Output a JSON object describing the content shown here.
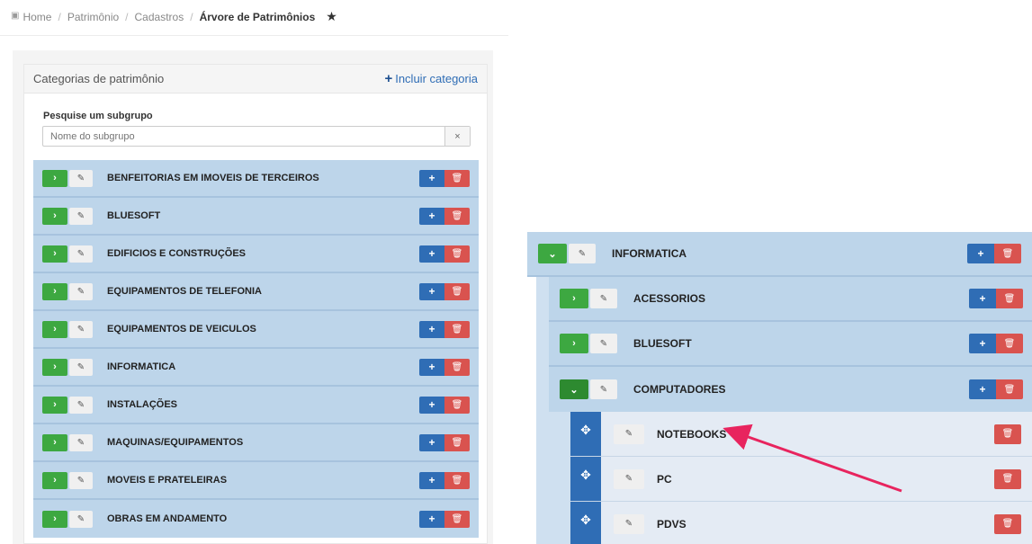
{
  "breadcrumb": {
    "home": "Home",
    "items": [
      "Patrimônio",
      "Cadastros"
    ],
    "current": "Árvore de Patrimônios",
    "favorite_icon": "star-icon"
  },
  "panel": {
    "title": "Categorias de patrimônio",
    "add_label": "Incluir categoria"
  },
  "search": {
    "label": "Pesquise um subgrupo",
    "placeholder": "Nome do subgrupo",
    "clear": "×"
  },
  "categories": [
    "BENFEITORIAS EM IMOVEIS DE TERCEIROS",
    "BLUESOFT",
    "EDIFICIOS E CONSTRUÇÕES",
    "EQUIPAMENTOS DE TELEFONIA",
    "EQUIPAMENTOS DE VEICULOS",
    "INFORMATICA",
    "INSTALAÇÕES",
    "MAQUINAS/EQUIPAMENTOS",
    "MOVEIS E PRATELEIRAS",
    "OBRAS EM ANDAMENTO"
  ],
  "tree": {
    "root": "INFORMATICA",
    "subgroups": [
      "ACESSORIOS",
      "BLUESOFT",
      "COMPUTADORES"
    ],
    "open_subgroup": "COMPUTADORES",
    "items": [
      "NOTEBOOKS",
      "PC",
      "PDVS"
    ]
  },
  "colors": {
    "row_bg": "#bdd5ea",
    "expand_green": "#3da841",
    "add_blue": "#2f6db5",
    "delete_red": "#d9534f",
    "arrow_pink": "#e8245e"
  },
  "icons": {
    "expand": "›",
    "collapse": "⌄",
    "edit": "✎",
    "add": "+",
    "delete": "🗑",
    "drag": "✥"
  }
}
